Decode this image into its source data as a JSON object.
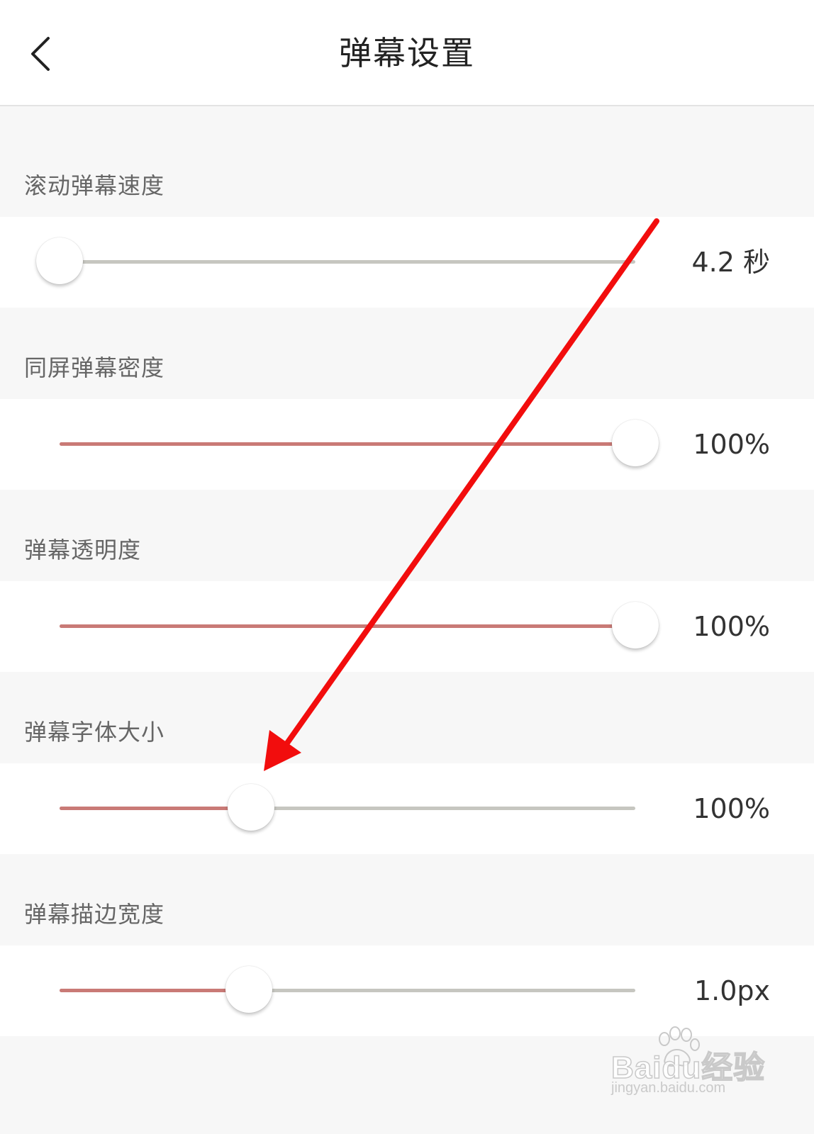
{
  "header": {
    "title": "弹幕设置",
    "back_icon": "chevron-left-icon"
  },
  "settings": [
    {
      "label": "滚动弹幕速度",
      "value": "4.2 秒",
      "level": 0.0
    },
    {
      "label": "同屏弹幕密度",
      "value": "100%",
      "level": 1.0
    },
    {
      "label": "弹幕透明度",
      "value": "100%",
      "level": 1.0
    },
    {
      "label": "弹幕字体大小",
      "value": "100%",
      "level": 0.333
    },
    {
      "label": "弹幕描边宽度",
      "value": "1.0px",
      "level": 0.329
    }
  ],
  "colors": {
    "accent_fill": "#c97a76",
    "track": "#c6c6c0",
    "annotation_arrow": "#f20d0d"
  },
  "watermark": {
    "brand": "Baidu经验",
    "url": "jingyan.baidu.com"
  }
}
